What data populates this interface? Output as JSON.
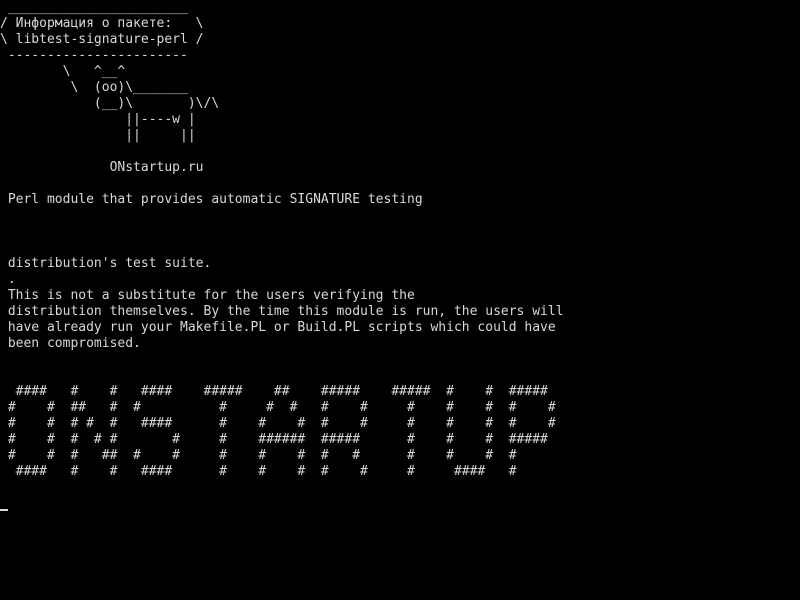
{
  "terminal": {
    "background": "#000000",
    "foreground": "#d8d8d8",
    "lines": [
      " _______________________",
      "/ Информация о пакете:   \\",
      "\\ libtest-signature-perl /",
      " -----------------------",
      "        \\   ^__^",
      "         \\  (oo)\\_______",
      "            (__)\\       )\\/\\",
      "                ||----w |",
      "                ||     ||",
      "",
      "              ONstartup.ru",
      "",
      " Perl module that provides automatic SIGNATURE testing",
      "",
      "",
      "",
      " distribution's test suite.",
      " .",
      " This is not a substitute for the users verifying the",
      " distribution themselves. By the time this module is run, the users will",
      " have already run your Makefile.PL or Build.PL scripts which could have",
      " been compromised.",
      "",
      "",
      "  ####   #    #   ####    #####    ##    #####    #####  #    #  #####",
      " #    #  ##   #  #          #     #  #   #    #     #    #    #  #    #",
      " #    #  # #  #   ####      #    #    #  #    #     #    #    #  #    #",
      " #    #  #  # #       #     #    ######  #####      #    #    #  #####",
      " #    #  #   ##  #    #     #    #    #  #   #      #    #    #  #",
      "  ####   #    #   ####      #    #    #  #    #     #     ####   #"
    ],
    "cursor": "_"
  }
}
